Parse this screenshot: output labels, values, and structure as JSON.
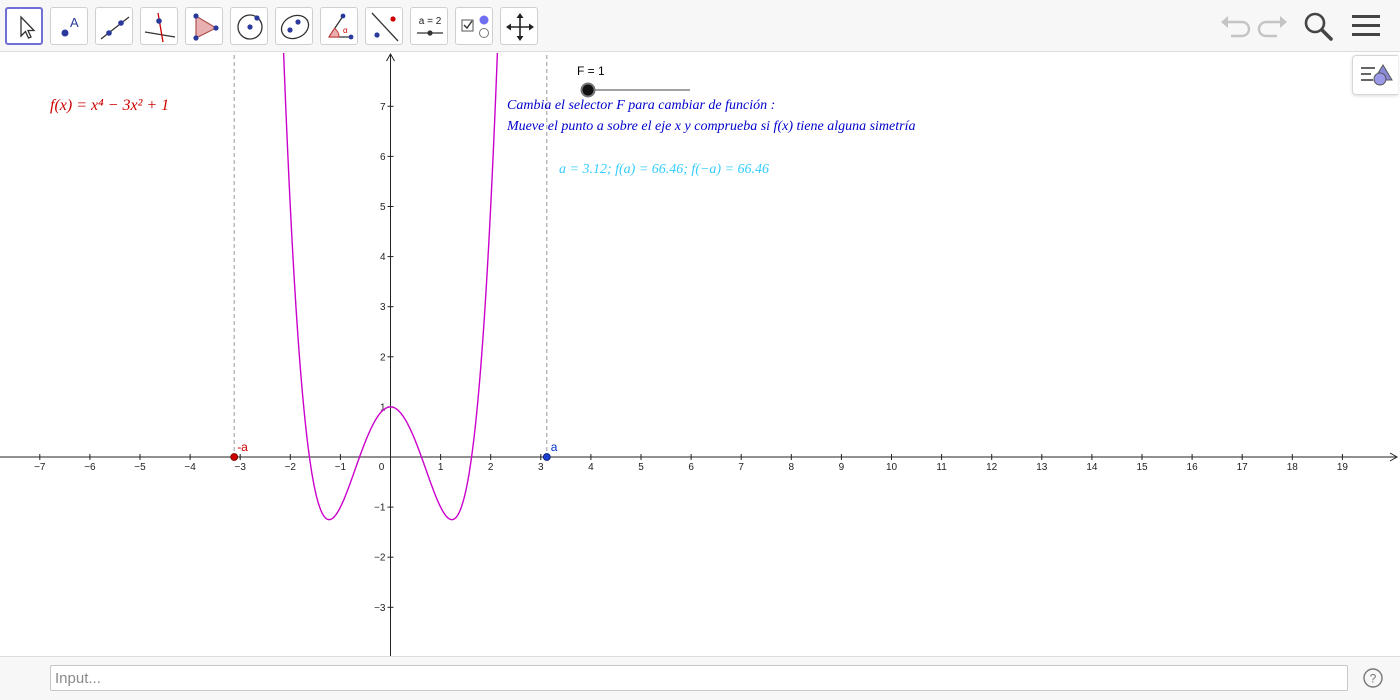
{
  "toolbar": {
    "tools": [
      {
        "name": "move-tool",
        "icon": "arrow-cursor-icon",
        "active": true
      },
      {
        "name": "point-tool",
        "icon": "point-label-icon"
      },
      {
        "name": "line-tool",
        "icon": "line-through-points-icon"
      },
      {
        "name": "perpendicular-line-tool",
        "icon": "perpendicular-line-icon"
      },
      {
        "name": "polygon-tool",
        "icon": "triangle-polygon-icon"
      },
      {
        "name": "circle-tool",
        "icon": "circle-center-point-icon"
      },
      {
        "name": "conic-tool",
        "icon": "ellipse-icon"
      },
      {
        "name": "angle-tool",
        "icon": "angle-icon"
      },
      {
        "name": "reflect-tool",
        "icon": "reflect-line-icon"
      },
      {
        "name": "slider-tool",
        "icon": "slider-icon",
        "label": "a = 2"
      },
      {
        "name": "checkbox-tool",
        "icon": "checkbox-icon"
      },
      {
        "name": "move-graphics-view-tool",
        "icon": "move-arrows-icon"
      }
    ],
    "right": [
      "undo-icon",
      "redo-icon",
      "search-icon",
      "menu-icon"
    ]
  },
  "graphics": {
    "function_label": "f(x) = x⁴ − 3x² + 1",
    "slider": {
      "label": "F = 1",
      "value": 1
    },
    "instruction_line1": "Cambia el selector F para cambiar de función :",
    "instruction_line2": "Mueve el punto a sobre el eje x y comprueba si f(x) tiene alguna simetría",
    "values_text": "a = 3.12;  f(a) = 66.46;  f(−a) = 66.46",
    "point_a": {
      "label": "a",
      "x": 3.12
    },
    "point_neg_a": {
      "label": "-a",
      "x": -3.12
    },
    "x_ticks": [
      "−7",
      "−6",
      "−5",
      "−4",
      "−3",
      "−2",
      "−1",
      "0",
      "1",
      "2",
      "3",
      "4",
      "5",
      "6",
      "7",
      "8",
      "9",
      "10",
      "11",
      "12",
      "13",
      "14",
      "15",
      "16",
      "17",
      "18",
      "19"
    ],
    "y_ticks": [
      "7",
      "6",
      "5",
      "4",
      "3",
      "2",
      "1",
      "−1",
      "−2",
      "−3"
    ],
    "colors": {
      "curve": "#cc00cc",
      "function_label": "#cc0000",
      "instructions": "#0000cc",
      "values": "#33ccff",
      "point_a": "#0033cc",
      "point_neg_a": "#cc0000"
    }
  },
  "input_bar": {
    "placeholder": "Input..."
  }
}
